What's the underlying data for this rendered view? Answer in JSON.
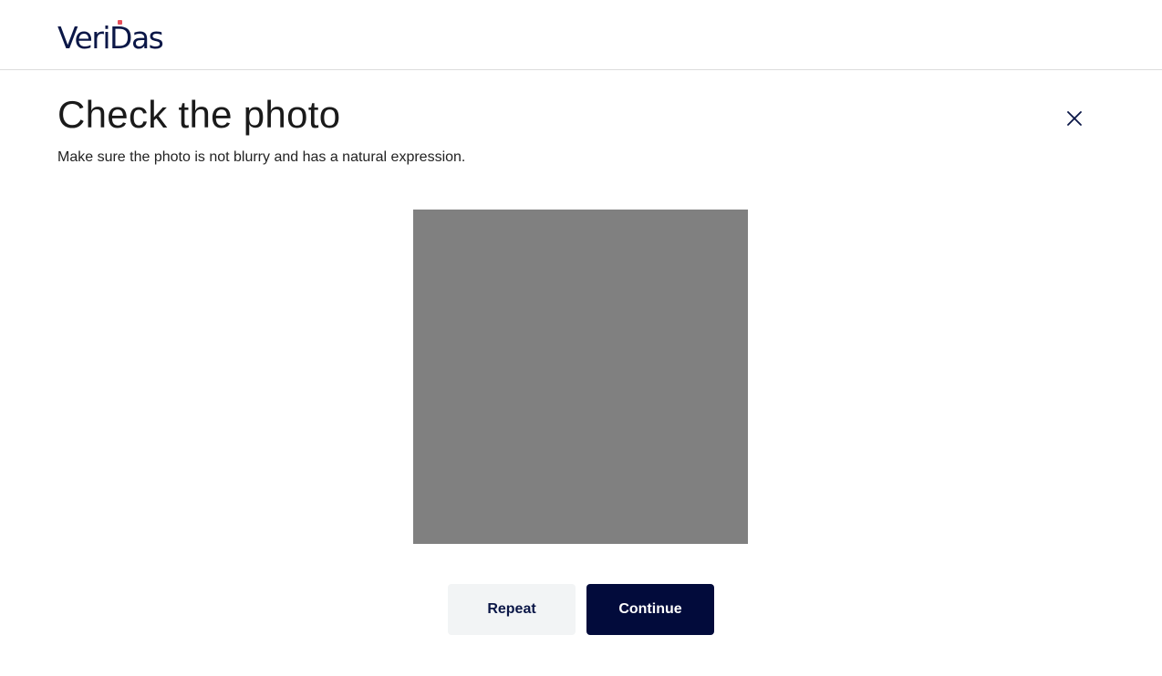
{
  "brand": {
    "logo_text": "VeriDas",
    "logo_color": "#0b1747",
    "accent_color": "#e8505b"
  },
  "page": {
    "title": "Check the photo",
    "subtitle": "Make sure the photo is not blurry and has a natural expression."
  },
  "close": {
    "icon": "close-icon"
  },
  "photo": {
    "placeholder_color": "#808080"
  },
  "actions": {
    "repeat_label": "Repeat",
    "continue_label": "Continue",
    "repeat_bg": "#f2f4f5",
    "continue_bg": "#020b3b"
  }
}
